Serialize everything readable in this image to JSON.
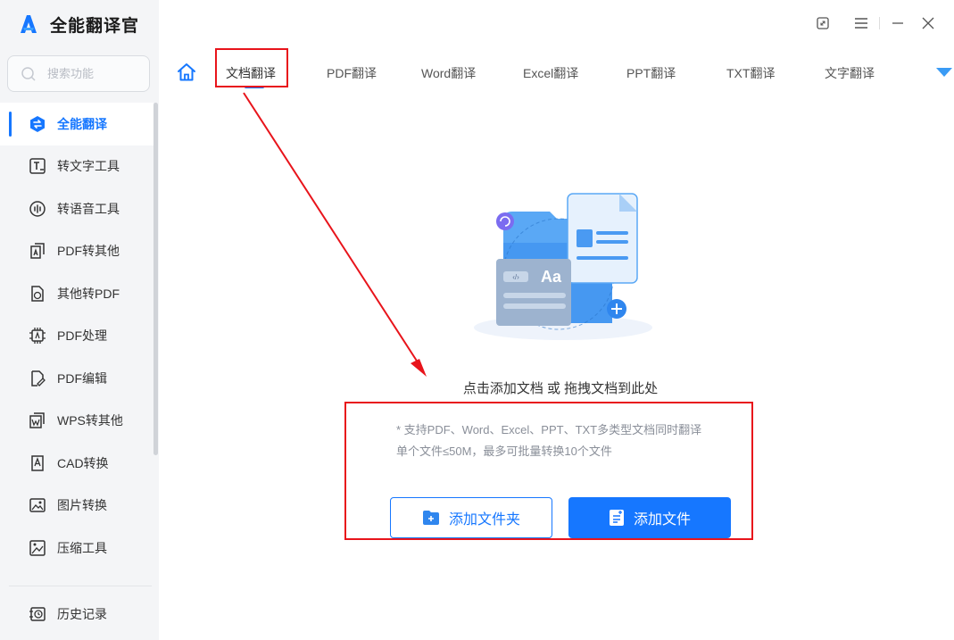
{
  "app": {
    "name": "全能翻译官"
  },
  "search": {
    "placeholder": "搜索功能"
  },
  "sidebar": {
    "items": [
      {
        "label": "全能翻译",
        "icon": "swap-icon",
        "active": true
      },
      {
        "label": "转文字工具",
        "icon": "text-tool-icon"
      },
      {
        "label": "转语音工具",
        "icon": "voice-wave-icon"
      },
      {
        "label": "PDF转其他",
        "icon": "pdf-convert-icon"
      },
      {
        "label": "其他转PDF",
        "icon": "to-pdf-icon"
      },
      {
        "label": "PDF处理",
        "icon": "chip-icon"
      },
      {
        "label": "PDF编辑",
        "icon": "pdf-edit-icon"
      },
      {
        "label": "WPS转其他",
        "icon": "wps-icon"
      },
      {
        "label": "CAD转换",
        "icon": "cad-icon"
      },
      {
        "label": "图片转换",
        "icon": "image-convert-icon"
      },
      {
        "label": "压缩工具",
        "icon": "compress-icon"
      }
    ],
    "history": {
      "label": "历史记录",
      "icon": "history-icon"
    }
  },
  "tabs": [
    {
      "label": "文档翻译",
      "active": true
    },
    {
      "label": "PDF翻译"
    },
    {
      "label": "Word翻译"
    },
    {
      "label": "Excel翻译"
    },
    {
      "label": "PPT翻译"
    },
    {
      "label": "TXT翻译"
    },
    {
      "label": "文字翻译"
    }
  ],
  "main": {
    "prompt": "点击添加文档 或 拖拽文档到此处",
    "note_line1": "* 支持PDF、Word、Excel、PPT、TXT多类型文档同时翻译",
    "note_line2": "单个文件≤50M，最多可批量转换10个文件",
    "add_folder_label": "添加文件夹",
    "add_file_label": "添加文件",
    "illus_text": "Aa"
  },
  "colors": {
    "accent": "#1677ff",
    "annotation": "#e8141b",
    "sidebar_bg": "#f4f5f7"
  }
}
